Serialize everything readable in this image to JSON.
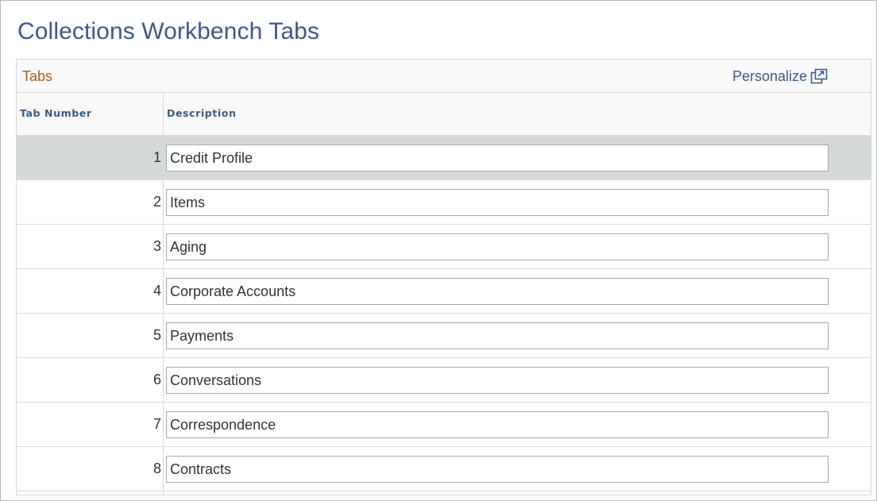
{
  "page": {
    "title": "Collections Workbench Tabs"
  },
  "grid": {
    "caption": "Tabs",
    "personalize_label": "Personalize",
    "separator": "|",
    "popout_icon": "popout-window-icon",
    "columns": [
      "Tab Number",
      "Description"
    ],
    "rows": [
      {
        "number": "1",
        "description": "Credit Profile",
        "selected": true
      },
      {
        "number": "2",
        "description": "Items"
      },
      {
        "number": "3",
        "description": "Aging"
      },
      {
        "number": "4",
        "description": "Corporate Accounts"
      },
      {
        "number": "5",
        "description": "Payments"
      },
      {
        "number": "6",
        "description": "Conversations"
      },
      {
        "number": "7",
        "description": "Correspondence"
      },
      {
        "number": "8",
        "description": "Contracts"
      }
    ]
  },
  "colors": {
    "title": "#3c5a86",
    "caption": "#b05d1c",
    "selected_row": "#d6dad6"
  }
}
